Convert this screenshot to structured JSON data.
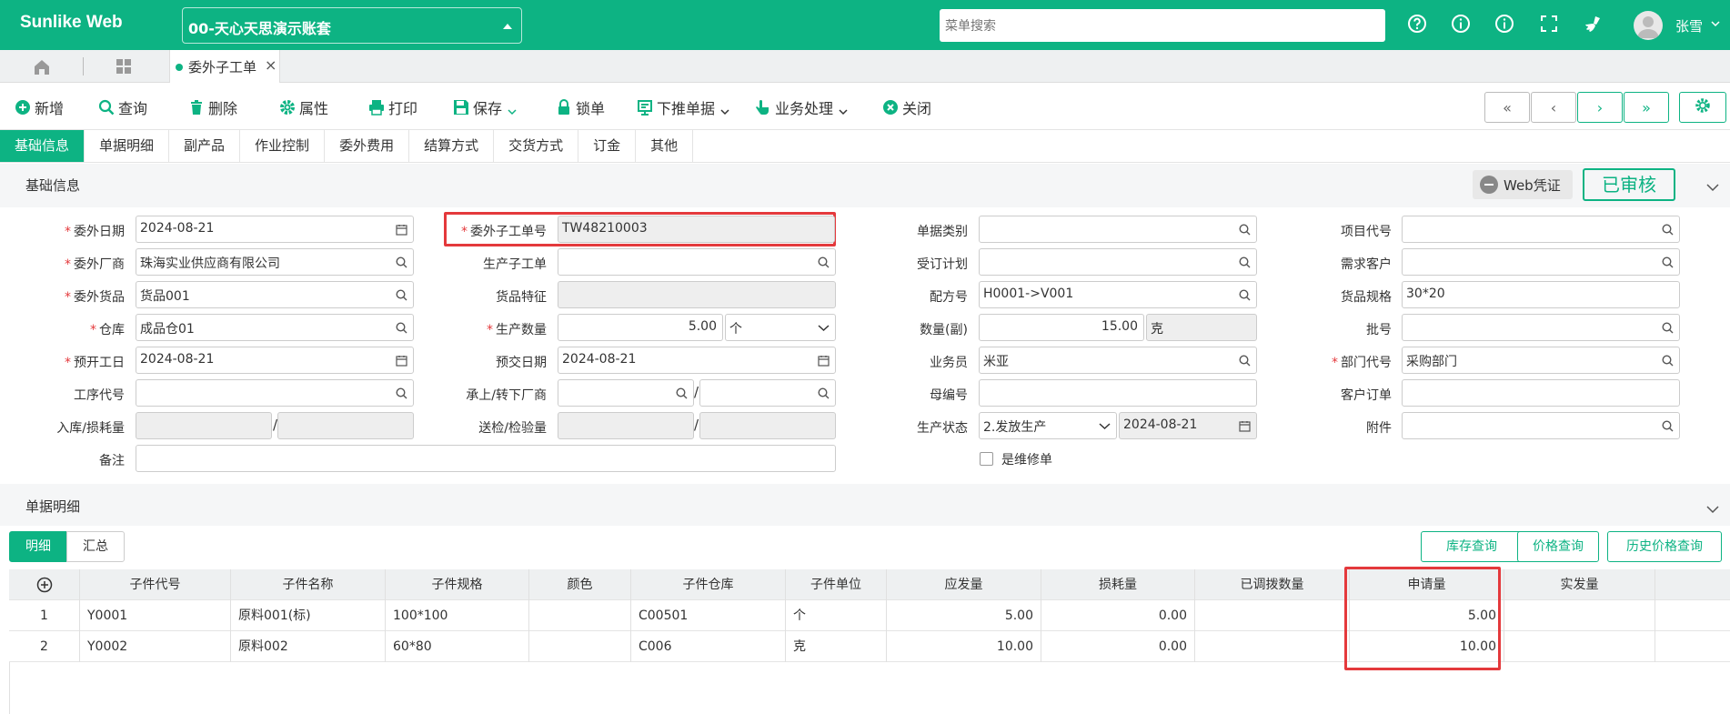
{
  "header": {
    "logo": "Sunlike Web",
    "account": "00-天心天思演示账套",
    "search_placeholder": "菜单搜索",
    "username": "张雪"
  },
  "tabs": {
    "doc_tab_label": "委外子工单"
  },
  "toolbar": {
    "new": "新增",
    "query": "查询",
    "delete": "删除",
    "properties": "属性",
    "print": "打印",
    "save": "保存",
    "lock": "锁单",
    "push_down": "下推单据",
    "business": "业务处理",
    "close": "关闭"
  },
  "section_tabs": [
    "基础信息",
    "单据明细",
    "副产品",
    "作业控制",
    "委外费用",
    "结算方式",
    "交货方式",
    "订金",
    "其他"
  ],
  "base_info": {
    "title": "基础信息",
    "web_voucher": "Web凭证",
    "status": "已审核"
  },
  "form": {
    "outsource_date_label": "委外日期",
    "outsource_date": "2024-08-21",
    "outsource_vendor_label": "委外厂商",
    "outsource_vendor": "珠海实业供应商有限公司",
    "outsource_goods_label": "委外货品",
    "outsource_goods": "货品001",
    "warehouse_label": "仓库",
    "warehouse": "成品仓01",
    "plan_start_label": "预开工日",
    "plan_start": "2024-08-21",
    "process_code_label": "工序代号",
    "process_code": "",
    "inbound_loss_label": "入库/损耗量",
    "remark_label": "备注",
    "remark": "",
    "suborder_no_label": "委外子工单号",
    "suborder_no": "TW48210003",
    "prod_suborder_label": "生产子工单",
    "prod_suborder": "",
    "goods_feature_label": "货品特征",
    "prod_qty_label": "生产数量",
    "prod_qty": "5.00",
    "prod_unit": "个",
    "delivery_date_label": "预交日期",
    "delivery_date": "2024-08-21",
    "transfer_vendor_label": "承上/转下厂商",
    "inspect_qty_label": "送检/检验量",
    "doc_type_label": "单据类别",
    "doc_type": "",
    "order_plan_label": "受订计划",
    "order_plan": "",
    "formula_label": "配方号",
    "formula": "H0001->V001",
    "qty_sub_label": "数量(副)",
    "qty_sub": "15.00",
    "qty_sub_unit": "克",
    "salesman_label": "业务员",
    "salesman": "米亚",
    "parent_no_label": "母编号",
    "parent_no": "",
    "prod_status_label": "生产状态",
    "prod_status": "2.发放生产",
    "prod_status_date": "2024-08-21",
    "repair_label": "是维修单",
    "project_label": "项目代号",
    "project": "",
    "demand_customer_label": "需求客户",
    "demand_customer": "",
    "goods_spec_label": "货品规格",
    "goods_spec": "30*20",
    "batch_label": "批号",
    "batch": "",
    "dept_label": "部门代号",
    "dept": "采购部门",
    "customer_order_label": "客户订单",
    "customer_order": "",
    "attachment_label": "附件",
    "attachment": ""
  },
  "detail": {
    "title": "单据明细",
    "subtab_detail": "明细",
    "subtab_summary": "汇总",
    "btn_stock": "库存查询",
    "btn_price": "价格查询",
    "btn_history_price": "历史价格查询",
    "columns": [
      "子件代号",
      "子件名称",
      "子件规格",
      "颜色",
      "子件仓库",
      "子件单位",
      "应发量",
      "损耗量",
      "已调拨数量",
      "申请量",
      "实发量"
    ],
    "rows": [
      {
        "no": "1",
        "code": "Y0001",
        "name": "原料001(标)",
        "spec": "100*100",
        "color": "",
        "warehouse": "C00501",
        "unit": "个",
        "required": "5.00",
        "loss": "0.00",
        "transferred": "",
        "applied": "5.00",
        "actual": ""
      },
      {
        "no": "2",
        "code": "Y0002",
        "name": "原料002",
        "spec": "60*80",
        "color": "",
        "warehouse": "C006",
        "unit": "克",
        "required": "10.00",
        "loss": "0.00",
        "transferred": "",
        "applied": "10.00",
        "actual": ""
      }
    ]
  },
  "colors": {
    "brand": "#0db383",
    "highlight": "#e4393c"
  }
}
